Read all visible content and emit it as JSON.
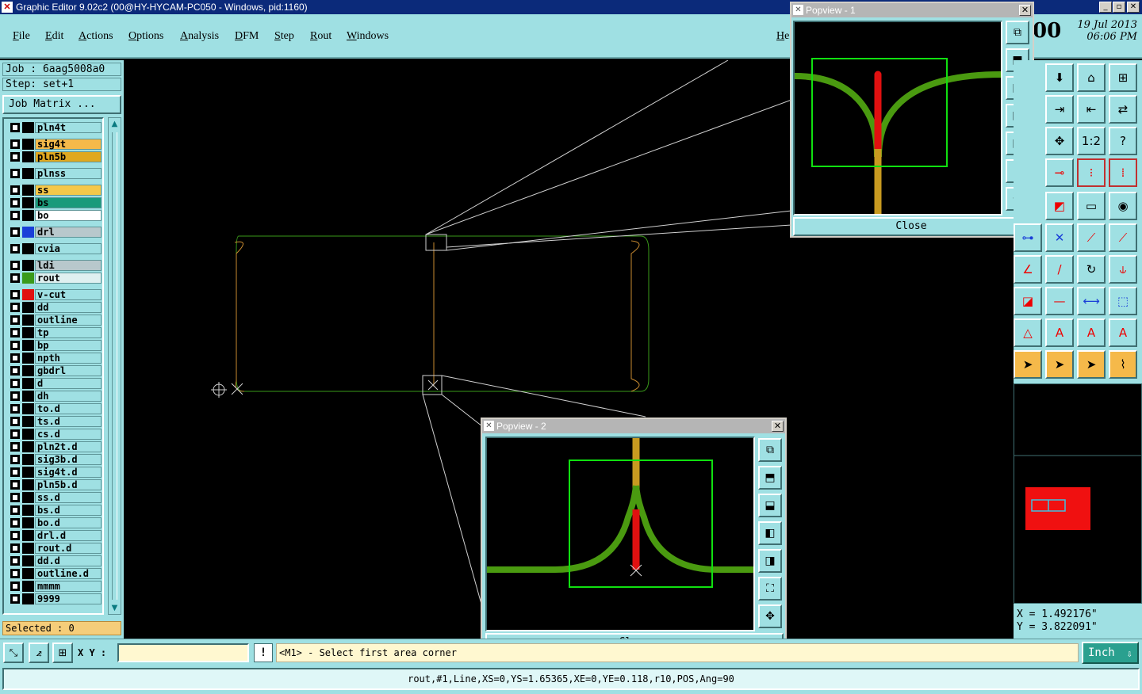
{
  "window": {
    "title": "Graphic Editor 9.02c2 (00@HY-HYCAM-PC050 - Windows, pid:1160)"
  },
  "menu": [
    "File",
    "Edit",
    "Actions",
    "Options",
    "Analysis",
    "DFM",
    "Step",
    "Rout",
    "Windows"
  ],
  "menu_help_partial": "He",
  "clock": {
    "time_partial": "00",
    "date": "19 Jul 2013",
    "time": "06:06 PM"
  },
  "job": {
    "job_line": "Job : 6aag5008a0",
    "step_line": "Step: set+1",
    "matrix_button": "Job Matrix ..."
  },
  "layers": [
    {
      "name": "pln4t",
      "color": "#9fe0e3",
      "swatch": "#000000"
    },
    {
      "name": "sig4t",
      "color": "#f5b94a",
      "swatch": "#000000"
    },
    {
      "name": "pln5b",
      "color": "#e0a820",
      "swatch": "#000000"
    },
    {
      "name": "plnss",
      "color": "#9fe0e3",
      "swatch": "#000000"
    },
    {
      "name": "ss",
      "color": "#f5c84a",
      "swatch": "#000000"
    },
    {
      "name": "bs",
      "color": "#1a9a7a",
      "swatch": "#000000"
    },
    {
      "name": "bo",
      "color": "#ffffff",
      "swatch": "#000000"
    },
    {
      "name": "drl",
      "color": "#b8c8cc",
      "swatch": "#1a3fd8"
    },
    {
      "name": "cvia",
      "color": "#9fe0e3",
      "swatch": "#000000"
    },
    {
      "name": "ldi",
      "color": "#b8c8cc",
      "swatch": "#000000"
    },
    {
      "name": "rout",
      "color": "#dff0f0",
      "swatch": "#3a9a1a"
    },
    {
      "name": "v-cut",
      "color": "#9fe0e3",
      "swatch": "#e01010"
    },
    {
      "name": "dd",
      "color": "#9fe0e3",
      "swatch": "#000000"
    },
    {
      "name": "outline",
      "color": "#9fe0e3",
      "swatch": "#000000"
    },
    {
      "name": "tp",
      "color": "#9fe0e3",
      "swatch": "#000000"
    },
    {
      "name": "bp",
      "color": "#9fe0e3",
      "swatch": "#000000"
    },
    {
      "name": "npth",
      "color": "#9fe0e3",
      "swatch": "#000000"
    },
    {
      "name": "gbdrl",
      "color": "#9fe0e3",
      "swatch": "#000000"
    },
    {
      "name": "d",
      "color": "#9fe0e3",
      "swatch": "#000000"
    },
    {
      "name": "dh",
      "color": "#9fe0e3",
      "swatch": "#000000"
    },
    {
      "name": "to.d",
      "color": "#9fe0e3",
      "swatch": "#000000"
    },
    {
      "name": "ts.d",
      "color": "#9fe0e3",
      "swatch": "#000000"
    },
    {
      "name": "cs.d",
      "color": "#9fe0e3",
      "swatch": "#000000"
    },
    {
      "name": "pln2t.d",
      "color": "#9fe0e3",
      "swatch": "#000000"
    },
    {
      "name": "sig3b.d",
      "color": "#9fe0e3",
      "swatch": "#000000"
    },
    {
      "name": "sig4t.d",
      "color": "#9fe0e3",
      "swatch": "#000000"
    },
    {
      "name": "pln5b.d",
      "color": "#9fe0e3",
      "swatch": "#000000"
    },
    {
      "name": "ss.d",
      "color": "#9fe0e3",
      "swatch": "#000000"
    },
    {
      "name": "bs.d",
      "color": "#9fe0e3",
      "swatch": "#000000"
    },
    {
      "name": "bo.d",
      "color": "#9fe0e3",
      "swatch": "#000000"
    },
    {
      "name": "drl.d",
      "color": "#9fe0e3",
      "swatch": "#000000"
    },
    {
      "name": "rout.d",
      "color": "#9fe0e3",
      "swatch": "#000000"
    },
    {
      "name": "dd.d",
      "color": "#9fe0e3",
      "swatch": "#000000"
    },
    {
      "name": "outline.d",
      "color": "#9fe0e3",
      "swatch": "#000000"
    },
    {
      "name": "mmmm",
      "color": "#9fe0e3",
      "swatch": "#000000"
    },
    {
      "name": "9999",
      "color": "#9fe0e3",
      "swatch": "#000000"
    }
  ],
  "selected": "Selected : 0",
  "popview1": {
    "title": "Popview - 1",
    "close": "Close"
  },
  "popview2": {
    "title": "Popview - 2",
    "close": "Close"
  },
  "coords": {
    "x": "X = 1.492176\"",
    "y": "Y = 3.822091\""
  },
  "command": {
    "xy_label": "X Y :",
    "xy_value": "",
    "bang": "!",
    "prompt": "<M1> - Select first area corner",
    "units": "Inch"
  },
  "status": "rout,#1,Line,XS=0,YS=1.65365,XE=0,YE=0.118,r10,POS,Ang=90",
  "colors": {
    "panel": "#9fe0e3",
    "rout_green": "#4a9a10",
    "vcut_red": "#e01010",
    "highlight_green": "#10e010",
    "overview_red": "#f01010"
  }
}
